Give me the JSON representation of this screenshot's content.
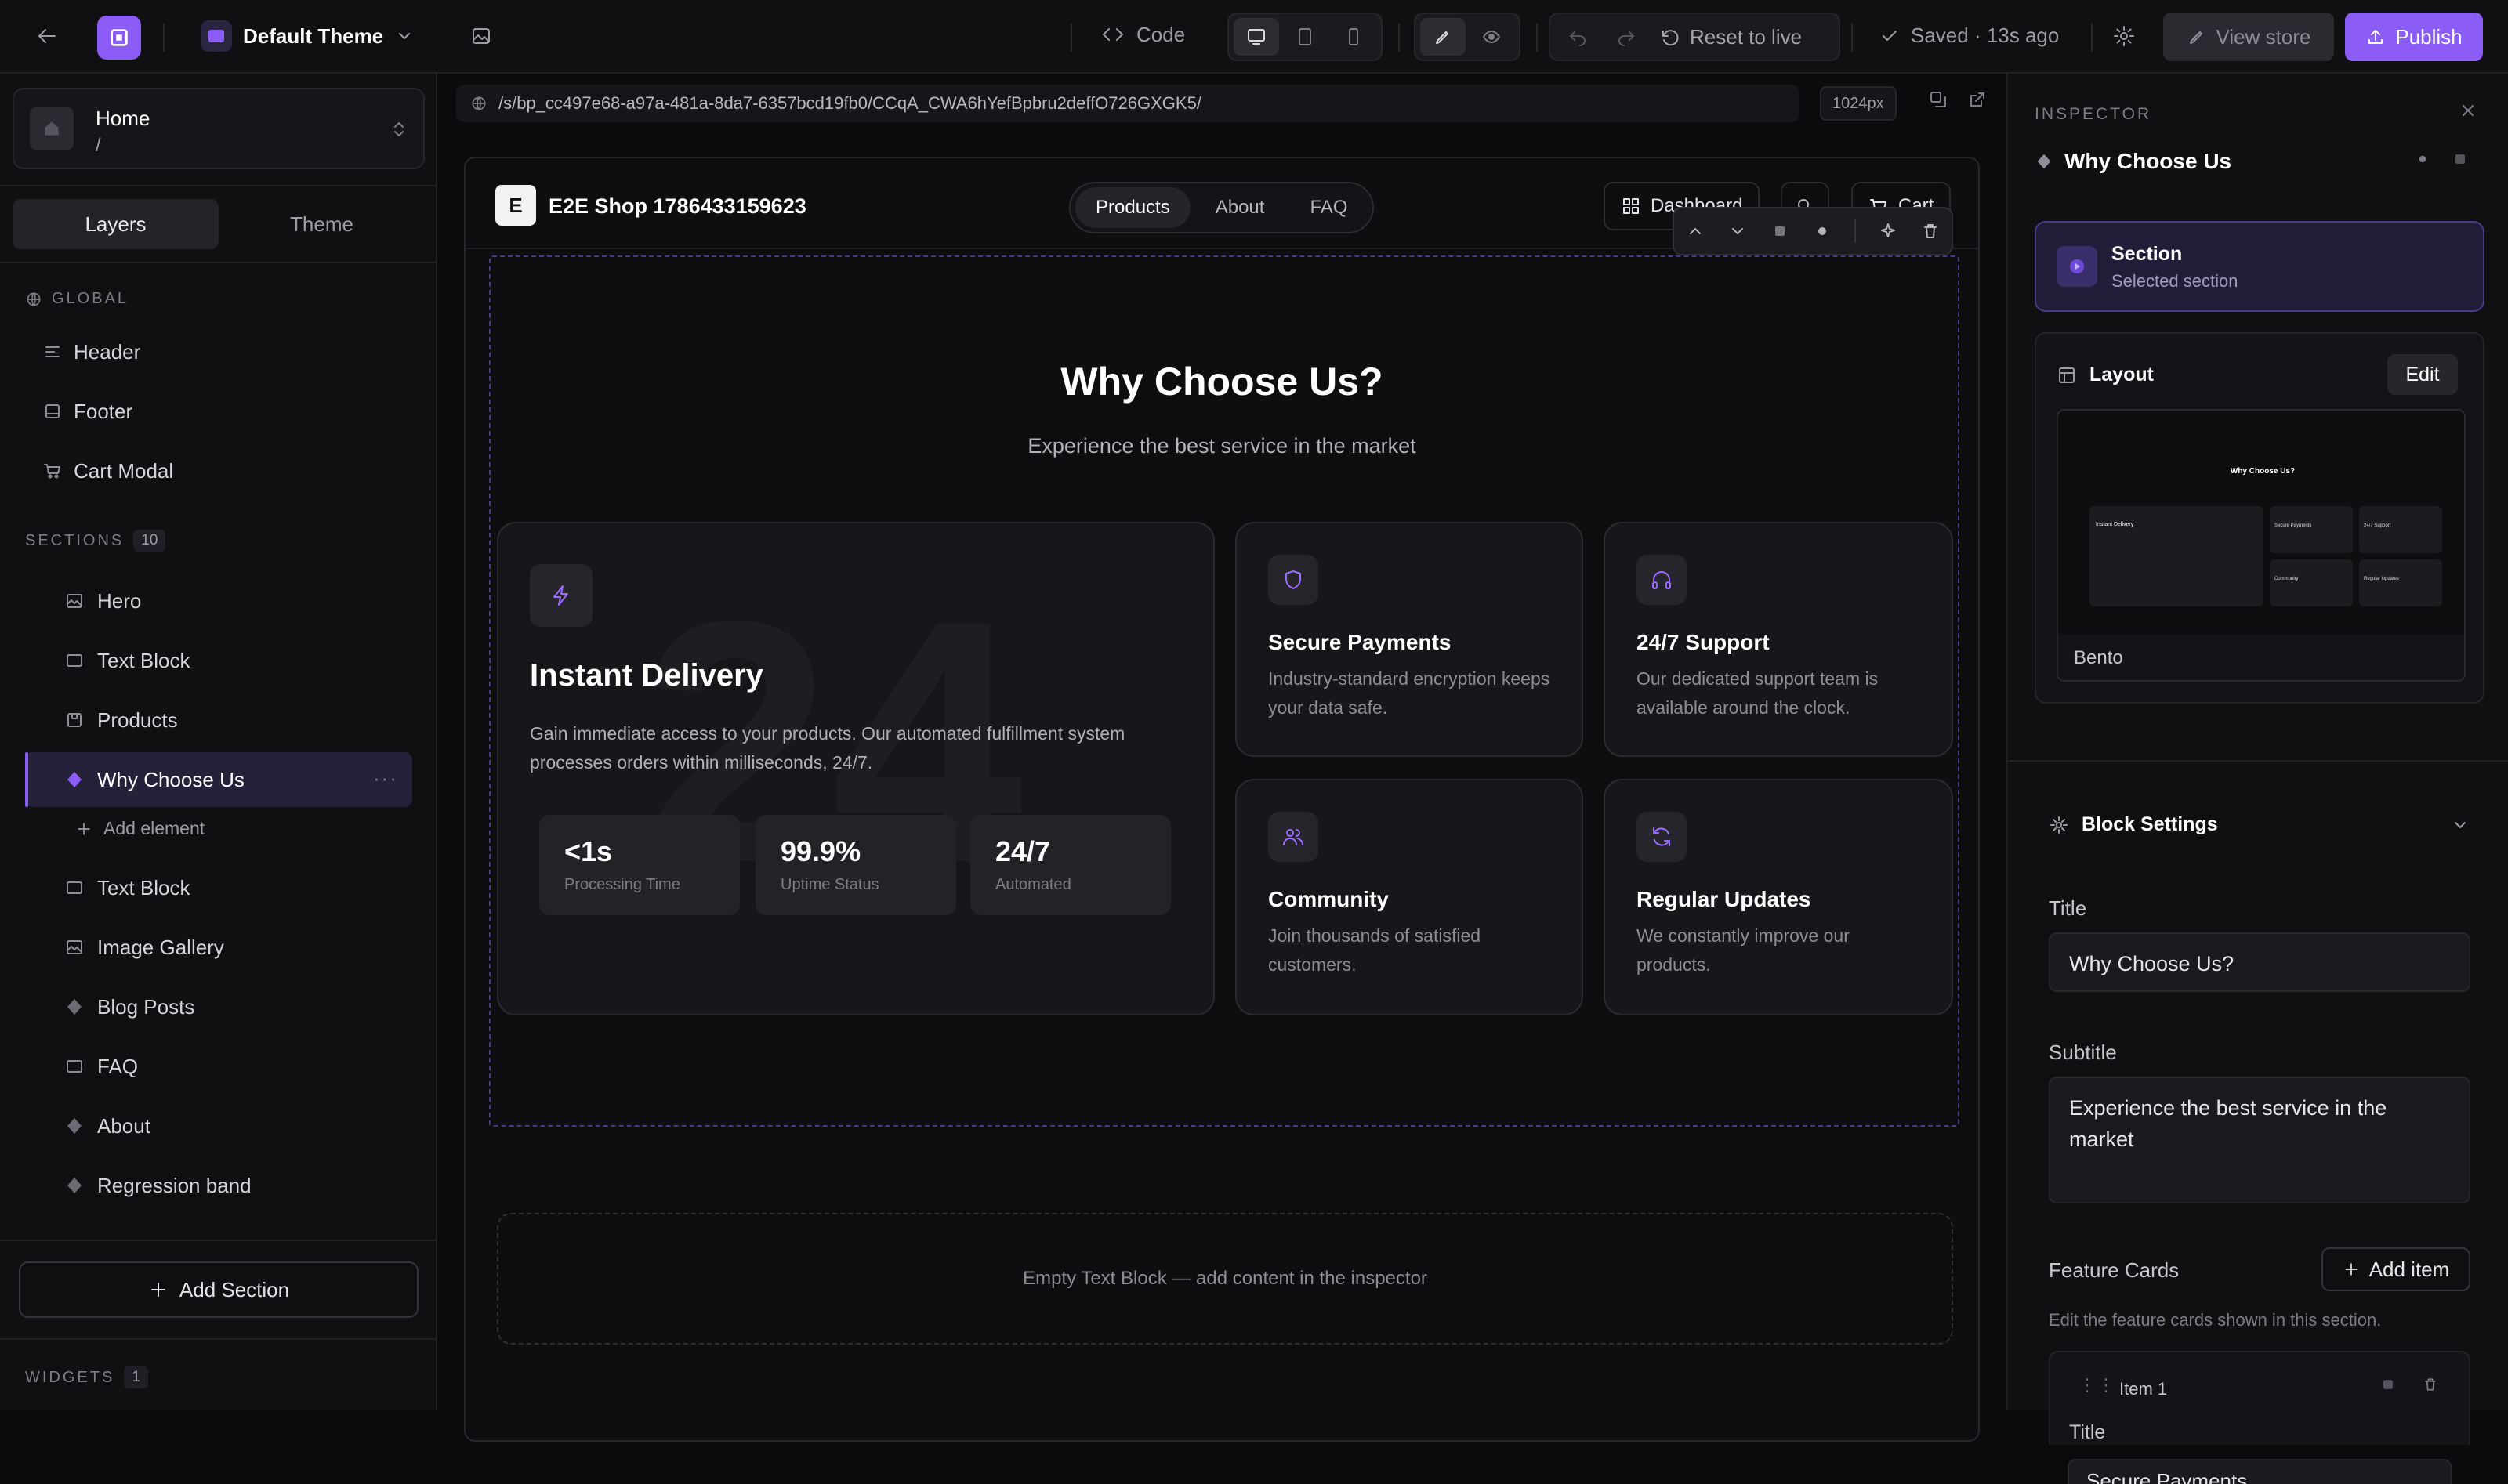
{
  "topbar": {
    "theme_name": "Default Theme",
    "code_label": "Code",
    "reset_label": "Reset to live",
    "saved_label": "Saved · 13s ago",
    "view_store_label": "View store",
    "publish_label": "Publish"
  },
  "left": {
    "page_name": "Home",
    "page_path": "/",
    "tab_layers": "Layers",
    "tab_theme": "Theme",
    "global_label": "GLOBAL",
    "global_items": [
      "Header",
      "Footer",
      "Cart Modal"
    ],
    "sections_label": "SECTIONS",
    "sections_count": "10",
    "sections": [
      "Hero",
      "Text Block",
      "Products",
      "Why Choose Us",
      "Text Block",
      "Image Gallery",
      "Blog Posts",
      "FAQ",
      "About",
      "Regression band"
    ],
    "add_element": "Add element",
    "add_section": "Add Section",
    "widgets_label": "WIDGETS",
    "widgets_count": "1"
  },
  "canvas": {
    "url": "/s/bp_cc497e68-a97a-481a-8da7-6357bcd19fb0/CCqA_CWA6hYefBpbru2deffO726GXGK5/",
    "width_label": "1024px",
    "shop": {
      "logo_letter": "E",
      "name": "E2E Shop 1786433159623",
      "nav": [
        "Products",
        "About",
        "FAQ"
      ],
      "dashboard_label": "Dashboard",
      "cart_label": "Cart"
    },
    "section": {
      "title": "Why Choose Us?",
      "subtitle": "Experience the best service in the market",
      "big_card": {
        "watermark": "24",
        "title": "Instant Delivery",
        "desc": "Gain immediate access to your products. Our automated fulfillment system processes orders within milliseconds, 24/7.",
        "stats": [
          {
            "value": "<1s",
            "label": "Processing Time"
          },
          {
            "value": "99.9%",
            "label": "Uptime Status"
          },
          {
            "value": "24/7",
            "label": "Automated"
          }
        ]
      },
      "cards": [
        {
          "title": "Secure Payments",
          "desc": "Industry-standard encryption keeps your data safe."
        },
        {
          "title": "24/7 Support",
          "desc": "Our dedicated support team is available around the clock."
        },
        {
          "title": "Community",
          "desc": "Join thousands of satisfied customers."
        },
        {
          "title": "Regular Updates",
          "desc": "We constantly improve our products."
        }
      ]
    },
    "empty_text": "Empty Text Block — add content in the inspector"
  },
  "inspector": {
    "header": "INSPECTOR",
    "block_name": "Why Choose Us",
    "section_label": "Section",
    "section_sub": "Selected section",
    "layout_label": "Layout",
    "edit_label": "Edit",
    "layout_name": "Bento",
    "preview_title": "Why Choose Us?",
    "preview_cards": [
      "Instant Delivery",
      "Secure Payments",
      "24/7 Support",
      "Community",
      "Regular Updates"
    ],
    "block_settings": "Block Settings",
    "title_label": "Title",
    "title_value": "Why Choose Us?",
    "subtitle_label": "Subtitle",
    "subtitle_value": "Experience the best service in the market",
    "feature_cards_label": "Feature Cards",
    "add_item": "Add item",
    "feature_help": "Edit the feature cards shown in this section.",
    "item_label": "Item 1",
    "item_title_label": "Title",
    "item_title_value": "Secure Payments"
  },
  "colors": {
    "accent": "#8b5cf6",
    "bg": "#0b0b0d",
    "panel": "#101013"
  }
}
